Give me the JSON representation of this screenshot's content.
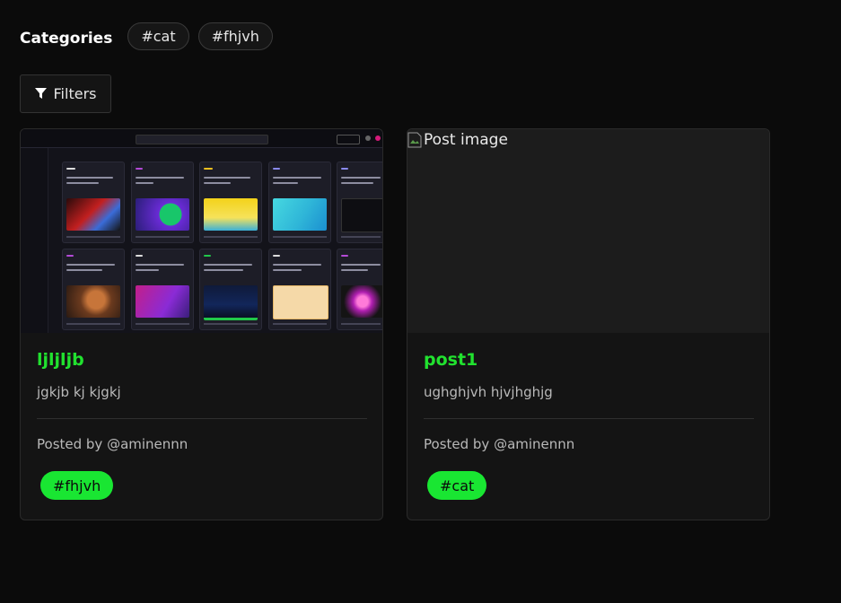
{
  "categories": {
    "title": "Categories",
    "chips": [
      "#cat",
      "#fhjvh"
    ]
  },
  "filters": {
    "label": "Filters",
    "icon": "filter-icon"
  },
  "posts": [
    {
      "title": "ljljljb",
      "description": "jgkjb kj kjgkj",
      "posted_by": "Posted by @aminennn",
      "tag": "#fhjvh",
      "image": "app-screenshot"
    },
    {
      "title": "post1",
      "description": "ughghjvh hjvjhghjg",
      "posted_by": "Posted by @aminennn",
      "tag": "#cat",
      "image_alt": "Post image"
    }
  ],
  "colors": {
    "background": "#0b0b0b",
    "card": "#141414",
    "accent_green": "#21e22f",
    "tag_green": "#19e632"
  }
}
